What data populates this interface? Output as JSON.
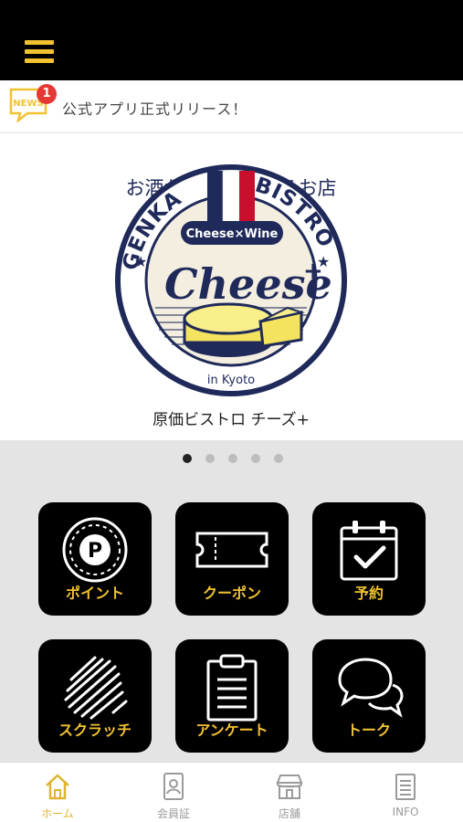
{
  "news": {
    "badge_count": "1",
    "label": "公式アプリ正式リリース！",
    "icon_text": "NEWS"
  },
  "logo": {
    "tagline": "お酒が原価で飲めるお店",
    "arc_left": "GENKA",
    "arc_right": "BISTRO",
    "ribbon": "Cheese×Wine",
    "script": "Cheese",
    "plus": "+",
    "location": "in Kyoto",
    "caption": "原価ビストロ チーズ+"
  },
  "carousel": {
    "page_count": 5,
    "active_index": 0
  },
  "menu": {
    "tiles": [
      {
        "label": "ポイント",
        "icon": "point-icon"
      },
      {
        "label": "クーポン",
        "icon": "coupon-icon"
      },
      {
        "label": "予約",
        "icon": "calendar-check-icon"
      },
      {
        "label": "スクラッチ",
        "icon": "scratch-icon"
      },
      {
        "label": "アンケート",
        "icon": "clipboard-icon"
      },
      {
        "label": "トーク",
        "icon": "chat-bubbles-icon"
      }
    ]
  },
  "tabbar": {
    "items": [
      {
        "label": "ホーム",
        "icon": "home-icon",
        "active": true
      },
      {
        "label": "会員証",
        "icon": "member-card-icon",
        "active": false
      },
      {
        "label": "店舗",
        "icon": "shop-icon",
        "active": false
      },
      {
        "label": "INFO",
        "icon": "info-document-icon",
        "active": false
      }
    ]
  },
  "colors": {
    "accent": "#f2c230",
    "tile_bg": "#000000",
    "logo_navy": "#1f2a5a",
    "cheese": "#f4e35e",
    "flag_red": "#c8102e"
  }
}
